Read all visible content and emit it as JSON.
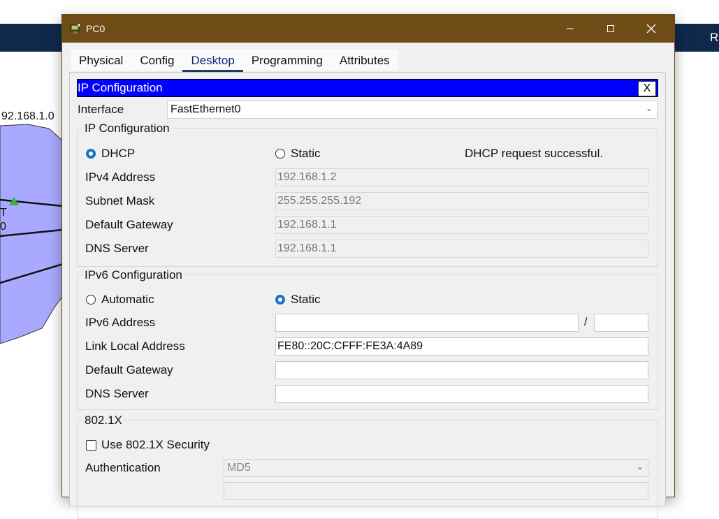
{
  "background": {
    "network_label": "92.168.1.0",
    "top_right_text": "R",
    "fragment_t": "T",
    "fragment_0": "0",
    "bar_color": "#10284b",
    "cloud_color": "#a9aaff"
  },
  "window": {
    "title": "PC0",
    "titlebar_color": "#6f4b15",
    "controls": {
      "minimize": "minimize-icon",
      "maximize": "maximize-icon",
      "close": "close-icon"
    }
  },
  "tabs": [
    {
      "label": "Physical",
      "active": false
    },
    {
      "label": "Config",
      "active": false
    },
    {
      "label": "Desktop",
      "active": true
    },
    {
      "label": "Programming",
      "active": false
    },
    {
      "label": "Attributes",
      "active": false
    }
  ],
  "ip_config": {
    "header_title": "IP Configuration",
    "close_label": "X",
    "interface_label": "Interface",
    "interface_value": "FastEthernet0",
    "ipv4": {
      "title": "IP Configuration",
      "dhcp_label": "DHCP",
      "static_label": "Static",
      "mode": "DHCP",
      "status_text": "DHCP request successful.",
      "ipv4_address_label": "IPv4 Address",
      "ipv4_address": "192.168.1.2",
      "subnet_mask_label": "Subnet Mask",
      "subnet_mask": "255.255.255.192",
      "default_gateway_label": "Default Gateway",
      "default_gateway": "192.168.1.1",
      "dns_server_label": "DNS Server",
      "dns_server": "192.168.1.1"
    },
    "ipv6": {
      "title": "IPv6 Configuration",
      "automatic_label": "Automatic",
      "static_label": "Static",
      "mode": "Static",
      "ipv6_address_label": "IPv6 Address",
      "ipv6_address": "",
      "prefix_separator": "/",
      "prefix_length": "",
      "link_local_label": "Link Local Address",
      "link_local": "FE80::20C:CFFF:FE3A:4A89",
      "default_gateway_label": "Default Gateway",
      "default_gateway": "",
      "dns_server_label": "DNS Server",
      "dns_server": ""
    },
    "dot1x": {
      "title": "802.1X",
      "use_label": "Use 802.1X Security",
      "use_checked": false,
      "auth_label": "Authentication",
      "auth_value": "MD5"
    }
  }
}
